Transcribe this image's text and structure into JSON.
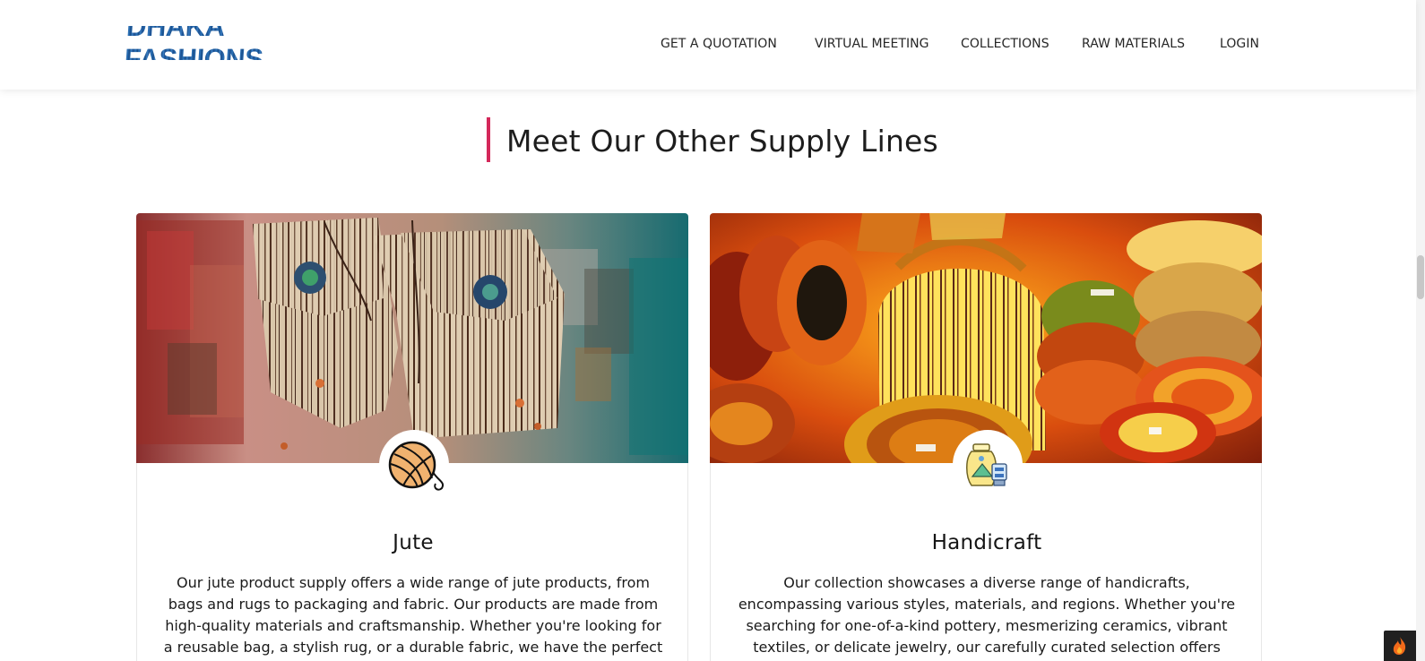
{
  "header": {
    "logo_text": "DHAKA FASHIONS",
    "nav": [
      {
        "label": "GET A QUOTATION"
      },
      {
        "label": "VIRTUAL MEETING"
      },
      {
        "label": "COLLECTIONS"
      },
      {
        "label": "RAW MATERIALS"
      },
      {
        "label": "LOGIN"
      }
    ]
  },
  "section": {
    "title": "Meet Our Other Supply Lines",
    "accent_color": "#d4285a"
  },
  "cards": [
    {
      "title": "Jute",
      "icon": "yarn-ball-icon",
      "text": "Our jute product supply offers a wide range of jute products, from bags and rugs to packaging and fabric. Our products are made from high-quality materials and craftsmanship. Whether you're looking for a reusable bag, a stylish rug, or a durable fabric, we have the perfect jute"
    },
    {
      "title": "Handicraft",
      "icon": "pottery-icon",
      "text": "Our collection showcases a diverse range of handicrafts, encompassing various styles, materials, and regions. Whether you're searching for one-of-a-kind pottery, mesmerizing ceramics, vibrant textiles, or delicate jewelry, our carefully curated selection offers something special for every"
    }
  ],
  "floating_widget": {
    "icon": "flame-icon"
  }
}
